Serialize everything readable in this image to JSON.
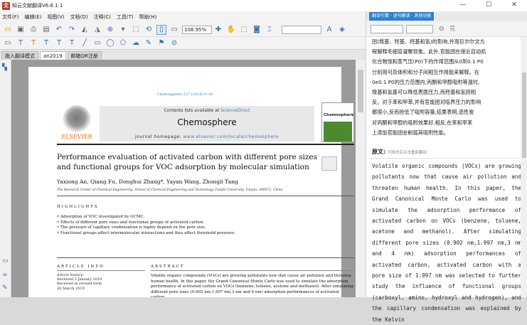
{
  "window": {
    "title": "知云文献翻译V6.6.1.1"
  },
  "menu": [
    "文件(F)",
    "编辑(E)",
    "视图(V)",
    "文档(D)",
    "注释(C)",
    "工具(T)",
    "帮助(H)"
  ],
  "toolbar": {
    "zoom": "108.95%"
  },
  "tabs": [
    "拖入翻译模式",
    "an2019",
    "邮箱QR注册"
  ],
  "paper": {
    "citation": "Chemosphere 227 (2019) 9–18",
    "contents_prefix": "Contents lists available at ",
    "contents_link": "ScienceDirect",
    "journal": "Chemosphere",
    "homepage_prefix": "journal homepage: ",
    "homepage_link": "www.elsevier.com/locate/chemosphere",
    "publisher": "ELSEVIER",
    "cover_title": "Chemosphere",
    "title": "Performance evaluation of activated carbon with different pore sizes and functional groups for VOC adsorption by molecular simulation",
    "authors": "Yaxiong An, Qiang Fu, Donghui Zhang*, Yayan Wang, Zhongli Tang",
    "affiliation": "The Research Center of Chemical Engineering, School of Chemical Engineering and Technology, Tianjin University, Tianjin, 300072, China",
    "highlights_head": "HIGHLIGHTS",
    "highlights": [
      "• Adsorption of VOC investigated by GCMC.",
      "• Effects of different pore sizes and functional groups of activated carbon.",
      "• The pressure of capillary condensation is highly depend on the pore size.",
      "• Functional groups affect intermolecular interactions and thus affect threshold pressure."
    ],
    "article_info_head": "ARTICLE INFO",
    "abstract_head": "ABSTRACT",
    "history": [
      "Article history:",
      "Received 3 January 2019",
      "Received in revised form",
      "28 March 2019"
    ],
    "abstract_lines": [
      "Volatile organic compounds (VOCs) are growing pollutants now that cause air pollution and threaten",
      "human health. In this paper, the Grand Canonical Monte Carlo was used to simulate the adsorption",
      "performance of activated carbon on VOCs (benzene, toluene, acetone and methanol). After simulating",
      "different pore sizes (0.902 nm,1.997 nm,3 nm and 4 nm) adsorption performances of activated carbon,"
    ]
  },
  "right": {
    "header_tabs": "翻译引擎 · 逐句解读 · 其他功能",
    "translation_lines": [
      "团(羧基、羟基、羟基和氢)的影响,并用巨尔尔文方",
      "程解释毛细管凝聚现象。此外,官能团在接近自动机",
      "化合物饱和蒸气压(P0)下的作用范围从0到0.1   P0",
      "分别用可及体积和分子间相互作用能来解释。在",
      "0e0.1 P0的压力范围内,丙酮和甲醇吸附等温时,",
      "羧基和氢基可以降低表面压力,而羟基和氢则相",
      "反。对于苯和甲苯,并有官能团对临界压力的影响",
      "都很小,反而抢低了吸附容量,结果表明,选性炭",
      "对丙酮和甲醇的吸附效果好,相反,在苯和甲苯",
      "上添加官能团会削弱其吸附性能。"
    ],
    "abstract_label": "原文:",
    "abstract_hint": "可修改后点击重新翻译",
    "abstract_text": "Volatile organic compounds (VOCs) are growing pollutants now that cause air pollution and threaten human health. In this paper, the Grand Canonical Monte Carlo was used to simulate the adsorption performance of activated carbon on VOCs (benzene, toluene, acetone and methanol). After simulating different pore sizes (0.902 nm,1.997 nm,3 nm and 4 nm) adsorption performances of activated carbon, activated carbon with a pore size of 1.997 nm was selected to further study the influence of functional groups (carboxyl, amino, hydroxyl and hydrogen), and the capillary condensation was explained by the Kelvin"
  }
}
